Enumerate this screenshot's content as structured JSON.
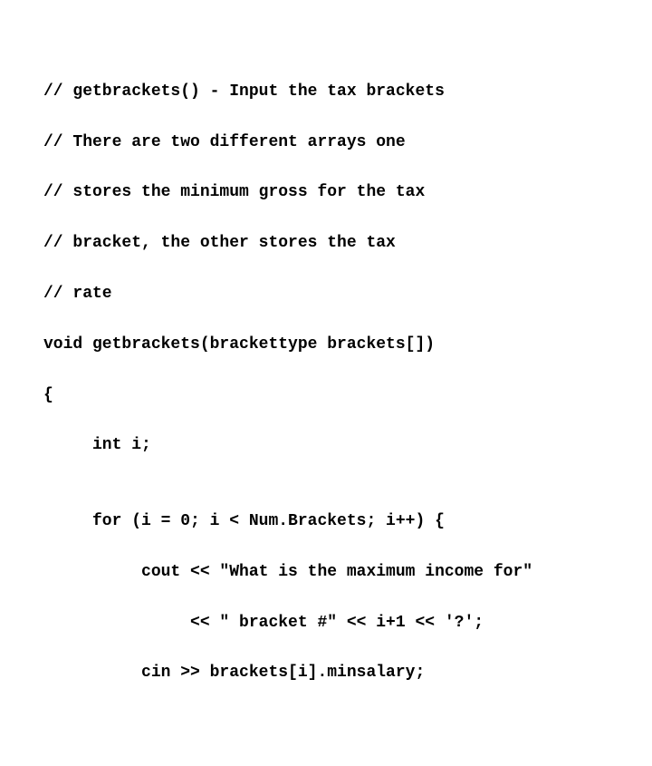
{
  "code": {
    "lines": [
      "// getbrackets() - Input the tax brackets",
      "// There are two different arrays one",
      "// stores the minimum gross for the tax",
      "// bracket, the other stores the tax",
      "// rate",
      "void getbrackets(brackettype brackets[])",
      "{",
      "     int i;",
      "",
      "     for (i = 0; i < Num.Brackets; i++) {",
      "          cout << \"What is the maximum income for\"",
      "               << \" bracket #\" << i+1 << '?';",
      "          cin >> brackets[i].minsalary;"
    ]
  }
}
